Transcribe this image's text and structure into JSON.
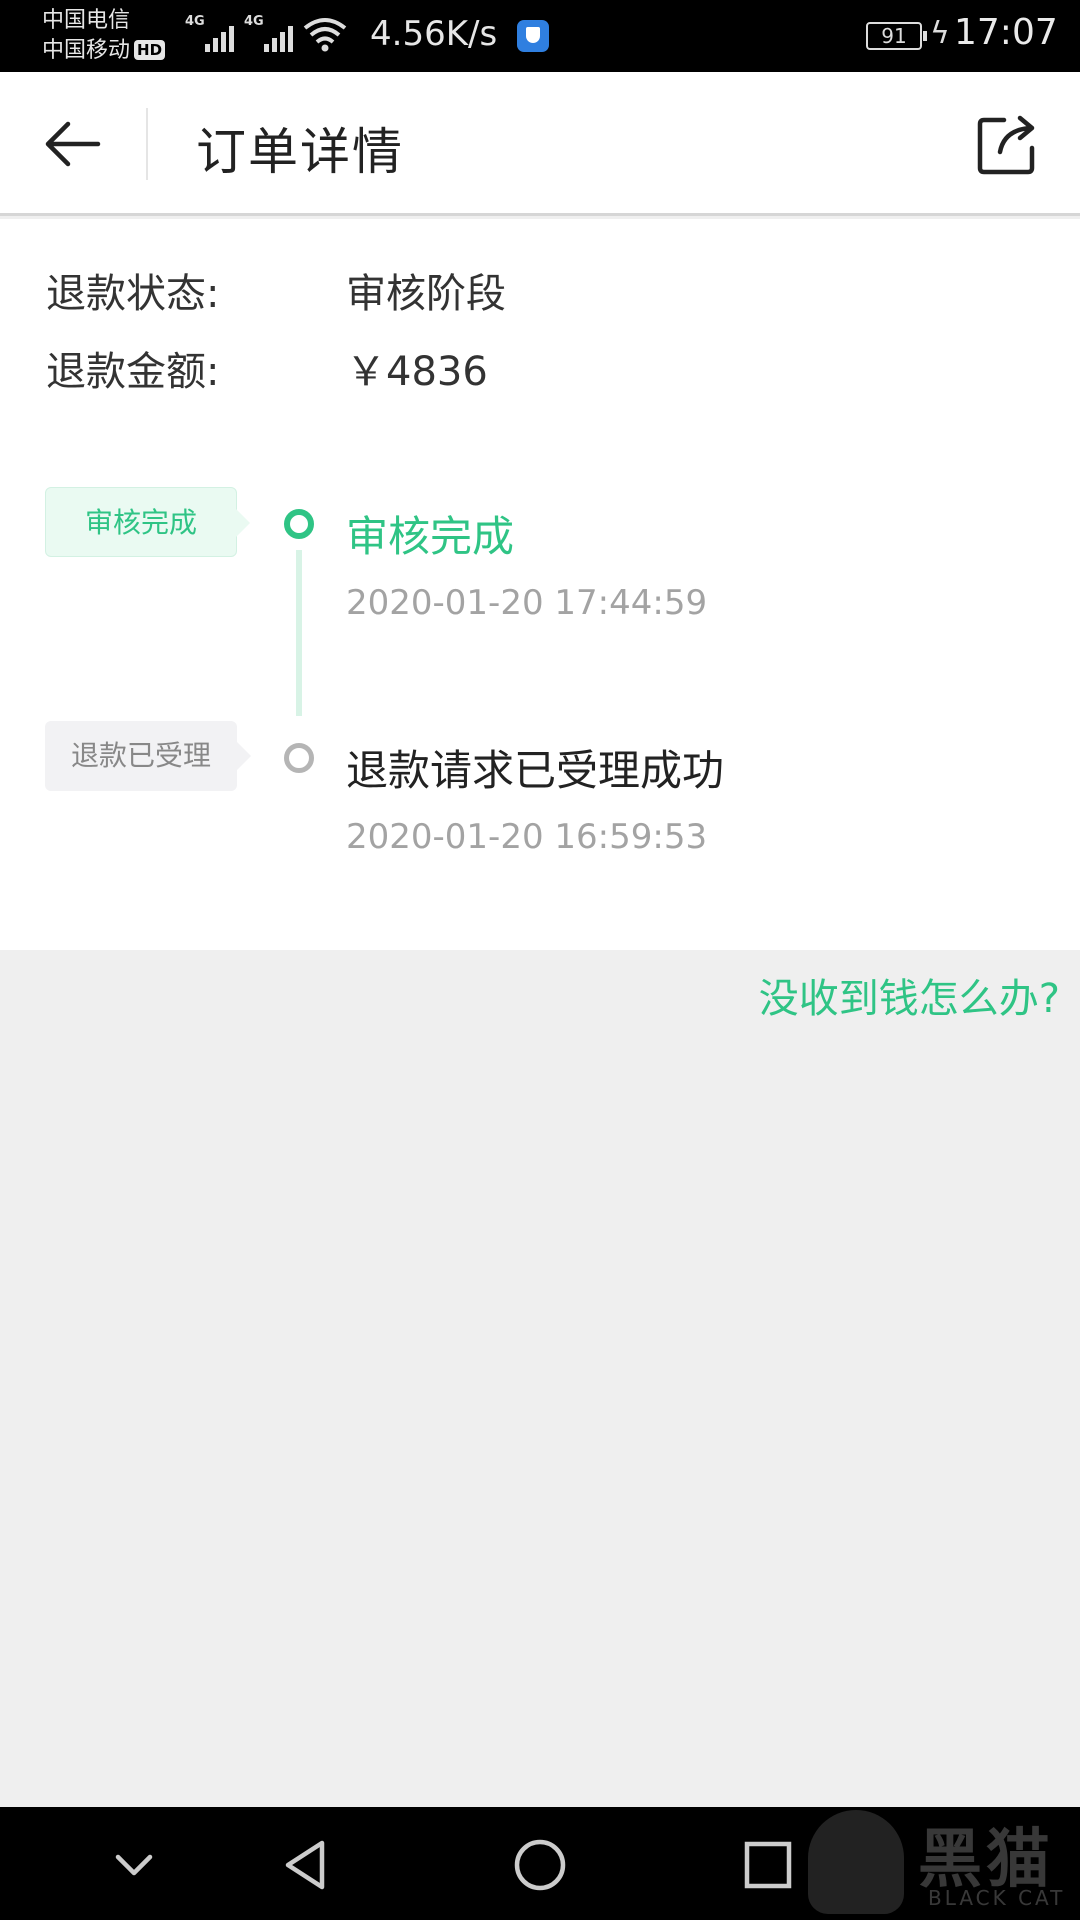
{
  "status_bar": {
    "carrier1": "中国电信",
    "carrier2": "中国移动",
    "hd": "HD",
    "net1": "4G",
    "net2": "4G",
    "speed": "4.56K/s",
    "battery": "91",
    "time": "17:07"
  },
  "header": {
    "title": "订单详情",
    "back_icon": "arrow-left-icon",
    "share_icon": "share-icon"
  },
  "refund": {
    "status_label": "退款状态:",
    "status_value": "审核阶段",
    "amount_label": "退款金额:",
    "amount_value": "￥4836"
  },
  "timeline": [
    {
      "tag": "审核完成",
      "title": "审核完成",
      "time": "2020-01-20 17:44:59",
      "active": true
    },
    {
      "tag": "退款已受理",
      "title": "退款请求已受理成功",
      "time": "2020-01-20 16:59:53",
      "active": false
    }
  ],
  "help_link": "没收到钱怎么办?",
  "nav": {
    "icons": [
      "chevron-down-icon",
      "back-triangle-icon",
      "home-circle-icon",
      "recents-square-icon"
    ]
  },
  "watermark": {
    "title": "黑猫",
    "subtitle": "BLACK CAT"
  },
  "colors": {
    "accent": "#2fc485",
    "muted": "#a3a3a3"
  }
}
